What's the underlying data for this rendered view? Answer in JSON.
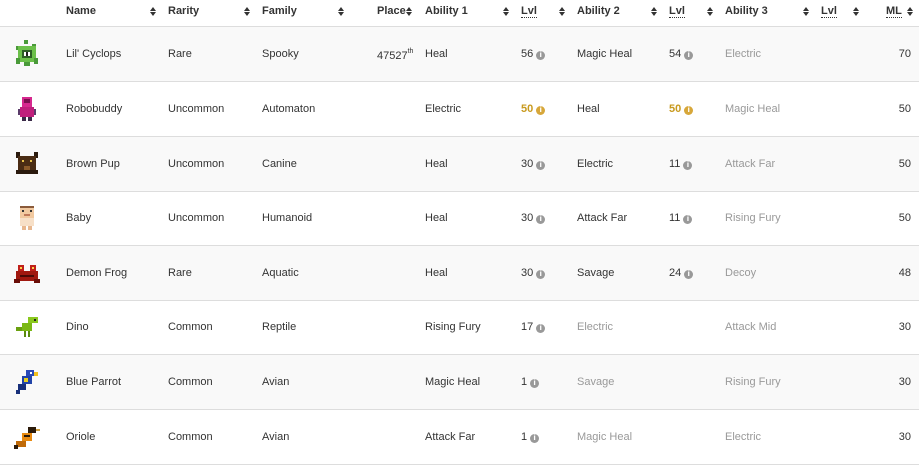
{
  "headers": {
    "name": "Name",
    "rarity": "Rarity",
    "family": "Family",
    "place": "Place",
    "ability1": "Ability 1",
    "lvl1": "Lvl",
    "ability2": "Ability 2",
    "lvl2": "Lvl",
    "ability3": "Ability 3",
    "lvl3": "Lvl",
    "ml": "ML"
  },
  "info_glyph": "i",
  "colors": {
    "gold": "#c89a1e",
    "muted": "#999999",
    "row_alt": "#f9f9f9",
    "border": "#dddddd"
  },
  "rows": [
    {
      "icon": "green-cyclops-pet-icon",
      "name": "Lil' Cyclops",
      "rarity": "Rare",
      "family": "Spooky",
      "place": "47527",
      "place_sup": "th",
      "a1": "Heal",
      "l1": "56",
      "a2": "Magic Heal",
      "l2": "54",
      "a3": "Electric",
      "l3": "",
      "ml": "70"
    },
    {
      "icon": "pink-robot-pet-icon",
      "name": "Robobuddy",
      "rarity": "Uncommon",
      "family": "Automaton",
      "place": "",
      "place_sup": "",
      "a1": "Electric",
      "l1": "50",
      "a2": "Heal",
      "l2": "50",
      "a3": "Magic Heal",
      "l3": "",
      "ml": "50"
    },
    {
      "icon": "brown-pup-pet-icon",
      "name": "Brown Pup",
      "rarity": "Uncommon",
      "family": "Canine",
      "place": "",
      "place_sup": "",
      "a1": "Heal",
      "l1": "30",
      "a2": "Electric",
      "l2": "11",
      "a3": "Attack Far",
      "l3": "",
      "ml": "50"
    },
    {
      "icon": "baby-pet-icon",
      "name": "Baby",
      "rarity": "Uncommon",
      "family": "Humanoid",
      "place": "",
      "place_sup": "",
      "a1": "Heal",
      "l1": "30",
      "a2": "Attack Far",
      "l2": "11",
      "a3": "Rising Fury",
      "l3": "",
      "ml": "50"
    },
    {
      "icon": "demon-frog-pet-icon",
      "name": "Demon Frog",
      "rarity": "Rare",
      "family": "Aquatic",
      "place": "",
      "place_sup": "",
      "a1": "Heal",
      "l1": "30",
      "a2": "Savage",
      "l2": "24",
      "a3": "Decoy",
      "l3": "",
      "ml": "48"
    },
    {
      "icon": "dino-pet-icon",
      "name": "Dino",
      "rarity": "Common",
      "family": "Reptile",
      "place": "",
      "place_sup": "",
      "a1": "Rising Fury",
      "l1": "17",
      "a2": "Electric",
      "l2": "",
      "a3": "Attack Mid",
      "l3": "",
      "ml": "30"
    },
    {
      "icon": "blue-parrot-pet-icon",
      "name": "Blue Parrot",
      "rarity": "Common",
      "family": "Avian",
      "place": "",
      "place_sup": "",
      "a1": "Magic Heal",
      "l1": "1",
      "a2": "Savage",
      "l2": "",
      "a3": "Rising Fury",
      "l3": "",
      "ml": "30"
    },
    {
      "icon": "oriole-pet-icon",
      "name": "Oriole",
      "rarity": "Common",
      "family": "Avian",
      "place": "",
      "place_sup": "",
      "a1": "Attack Far",
      "l1": "1",
      "a2": "Magic Heal",
      "l2": "",
      "a3": "Electric",
      "l3": "",
      "ml": "30"
    }
  ]
}
